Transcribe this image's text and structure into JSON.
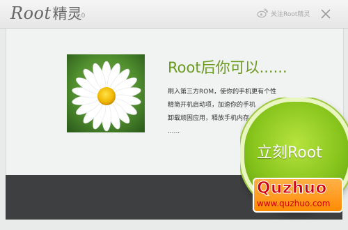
{
  "window": {
    "app_name_en": "Root",
    "app_name_cn": "精灵",
    "version": "1.0",
    "follow_text": "关注Root精灵",
    "close_glyph": "✕"
  },
  "main": {
    "headline": "Root后你可以......",
    "lines": [
      "刷入第三方ROM，使你的手机更有个性",
      "精简开机启动项，加速你的手机",
      "卸载顽固应用，释放手机内存",
      "......"
    ],
    "button_label": "立刻Root"
  },
  "watermark": {
    "top": "Quzhuo",
    "bottom": "www.quzhuo.com"
  },
  "colors": {
    "accent_green": "#6a9a1c",
    "button_green": "#86c41c",
    "bottom_bar": "#3d3f40"
  },
  "icons": {
    "follow": "weibo-icon",
    "close": "close-icon",
    "image": "daisy-flower"
  }
}
